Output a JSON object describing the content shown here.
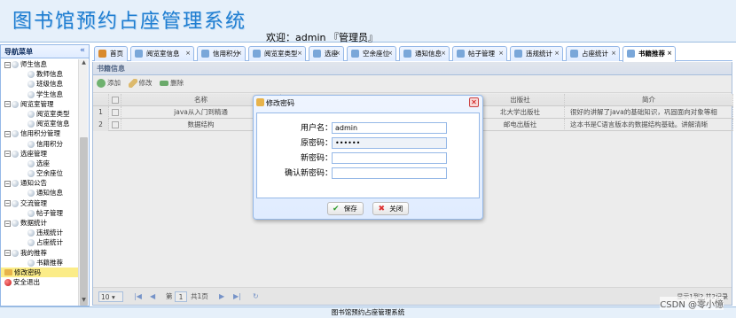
{
  "app": {
    "title": "图书馆预约占座管理系统",
    "welcome": "欢迎：admin 『管理员』",
    "footer": "图书馆预约占座管理系统",
    "watermark": "CSDN @零小憶"
  },
  "sidebar": {
    "title": "导航菜单",
    "collapse_icon": "«",
    "items": [
      {
        "label": "师生信息",
        "level": 1,
        "type": "folder"
      },
      {
        "label": "教师信息",
        "level": 2,
        "type": "leaf"
      },
      {
        "label": "班级信息",
        "level": 2,
        "type": "leaf"
      },
      {
        "label": "学生信息",
        "level": 2,
        "type": "leaf"
      },
      {
        "label": "阅览室管理",
        "level": 1,
        "type": "folder"
      },
      {
        "label": "阅览室类型",
        "level": 2,
        "type": "leaf"
      },
      {
        "label": "阅览室信息",
        "level": 2,
        "type": "leaf"
      },
      {
        "label": "信用积分管理",
        "level": 1,
        "type": "folder"
      },
      {
        "label": "信用积分",
        "level": 2,
        "type": "leaf"
      },
      {
        "label": "选座管理",
        "level": 1,
        "type": "folder"
      },
      {
        "label": "选座",
        "level": 2,
        "type": "leaf"
      },
      {
        "label": "空余座位",
        "level": 2,
        "type": "leaf"
      },
      {
        "label": "通知公告",
        "level": 1,
        "type": "folder"
      },
      {
        "label": "通知信息",
        "level": 2,
        "type": "leaf"
      },
      {
        "label": "交流管理",
        "level": 1,
        "type": "folder"
      },
      {
        "label": "帖子管理",
        "level": 2,
        "type": "leaf"
      },
      {
        "label": "数据统计",
        "level": 1,
        "type": "folder"
      },
      {
        "label": "违规统计",
        "level": 2,
        "type": "leaf"
      },
      {
        "label": "占座统计",
        "level": 2,
        "type": "leaf"
      },
      {
        "label": "我的推荐",
        "level": 1,
        "type": "folder"
      },
      {
        "label": "书籍推荐",
        "level": 2,
        "type": "leaf"
      },
      {
        "label": "修改密码",
        "level": 0,
        "type": "key",
        "selected": true
      },
      {
        "label": "安全退出",
        "level": 0,
        "type": "exit"
      }
    ]
  },
  "tabs": [
    {
      "label": "首页",
      "icon": "home-icon",
      "closable": false
    },
    {
      "label": "阅览室信息",
      "closable": true
    },
    {
      "label": "信用积分",
      "closable": true
    },
    {
      "label": "阅览室类型",
      "closable": true
    },
    {
      "label": "选座",
      "closable": true
    },
    {
      "label": "空余座位",
      "closable": true
    },
    {
      "label": "通知信息",
      "closable": true
    },
    {
      "label": "帖子管理",
      "closable": true
    },
    {
      "label": "违规统计",
      "closable": true
    },
    {
      "label": "占座统计",
      "closable": true
    },
    {
      "label": "书籍推荐",
      "closable": true,
      "active": true
    }
  ],
  "panel": {
    "title": "书籍信息",
    "toolbar": {
      "add": "添加",
      "edit": "修改",
      "delete": "删除"
    },
    "columns": {
      "name": "名称",
      "publisher": "出版社",
      "intro": "简介"
    },
    "rows": [
      {
        "num": "1",
        "name": "java从入门到精通",
        "publisher": "北大学出版社",
        "intro": "很好的讲解了java的基础知识，巩固面向对象等相"
      },
      {
        "num": "2",
        "name": "数据结构",
        "publisher": "邮电出版社",
        "intro": "这本书是C语言版本的数据结构基础。讲解清晰"
      }
    ],
    "pager": {
      "page_size": "10",
      "page_label": "第",
      "page_value": "1",
      "total_pages": "共1页",
      "summary": "显示1到2,共2记录"
    }
  },
  "dialog": {
    "title": "修改密码",
    "fields": {
      "username_label": "用户名：",
      "username_value": "admin",
      "old_pwd_label": "原密码：",
      "old_pwd_value": "••••••",
      "new_pwd_label": "新密码：",
      "new_pwd_value": "",
      "confirm_pwd_label": "确认新密码：",
      "confirm_pwd_value": ""
    },
    "save_label": "保存",
    "close_label": "关闭"
  },
  "colors": {
    "accent": "#95b8e7",
    "title_blue": "#1f7ed1",
    "selected": "#fbec88"
  }
}
